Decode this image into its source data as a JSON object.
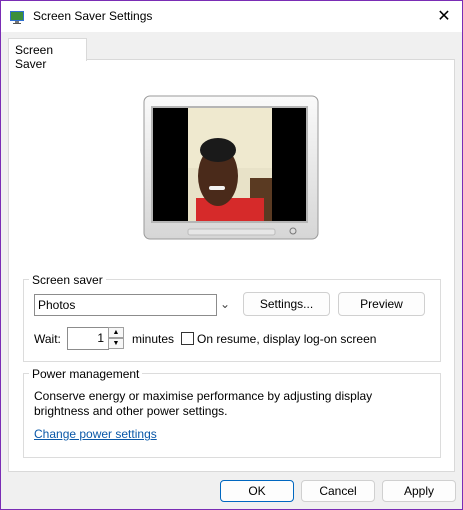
{
  "window": {
    "title": "Screen Saver Settings",
    "close_glyph": "✕"
  },
  "tabs": [
    {
      "label": "Screen Saver",
      "active": true
    }
  ],
  "screen_saver": {
    "group_label": "Screen saver",
    "selected": "Photos",
    "settings_label": "Settings...",
    "preview_label": "Preview",
    "wait_label": "Wait:",
    "wait_value": "1",
    "minutes_label": "minutes",
    "resume_label": "On resume, display log-on screen",
    "resume_checked": false
  },
  "power": {
    "group_label": "Power management",
    "description": "Conserve energy or maximise performance by adjusting display brightness and other power settings.",
    "link_label": "Change power settings"
  },
  "footer": {
    "ok_label": "OK",
    "cancel_label": "Cancel",
    "apply_label": "Apply"
  },
  "colors": {
    "accent": "#7a2db5",
    "link": "#0a58a8",
    "button_focus": "#0067c0"
  },
  "icons": {
    "app": "monitor-icon",
    "close": "close-icon",
    "dropdown": "chevron-down-icon"
  }
}
